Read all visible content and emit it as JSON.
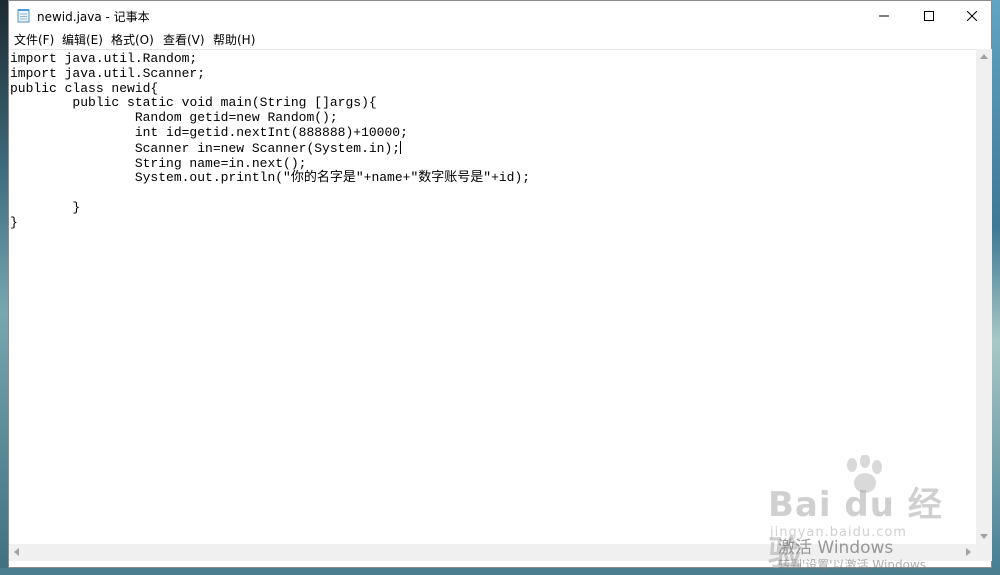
{
  "window": {
    "title": "newid.java - 记事本"
  },
  "menu": {
    "items": [
      {
        "label": "文件(F)"
      },
      {
        "label": "编辑(E)"
      },
      {
        "label": "格式(O)"
      },
      {
        "label": "查看(V)"
      },
      {
        "label": "帮助(H)"
      }
    ]
  },
  "editor": {
    "lines": [
      "import java.util.Random;",
      "import java.util.Scanner;",
      "public class newid{",
      "\tpublic static void main(String []args){",
      "\t\tRandom getid=new Random();",
      "\t\tint id=getid.nextInt(888888)+10000;",
      "\t\tScanner in=new Scanner(System.in);",
      "\t\tString name=in.next();",
      "\t\tSystem.out.println(\"你的名字是\"+name+\"数字账号是\"+id);",
      "",
      "\t}",
      "}"
    ],
    "caret_line": 6
  },
  "overlay": {
    "watermark_brand": "Bai du 经验",
    "watermark_site": "jingyan.baidu.com",
    "activate_text": "激活 Windows",
    "activate_sub": "转到'设置'以激活 Windows"
  }
}
